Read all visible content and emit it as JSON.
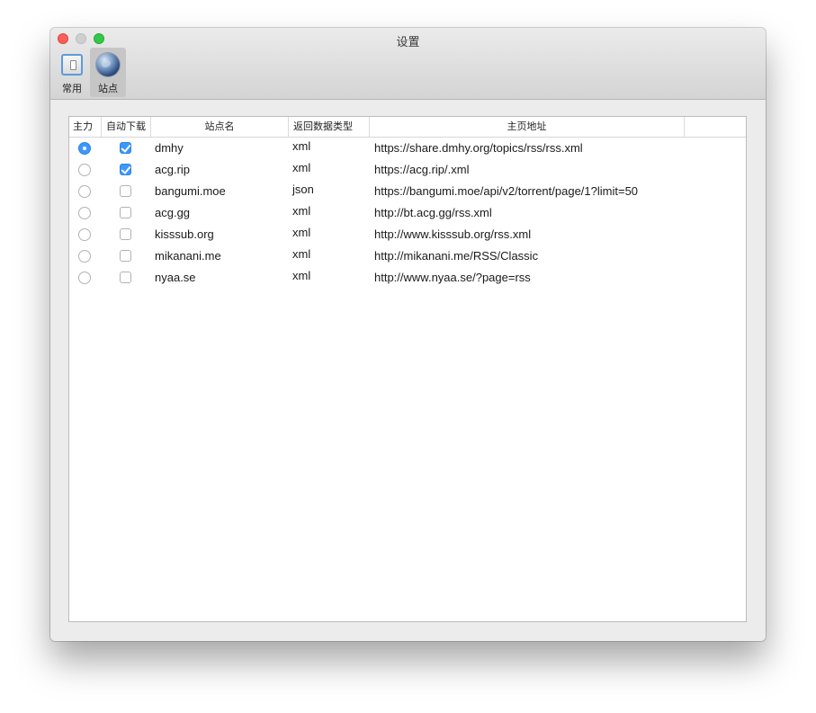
{
  "window": {
    "title": "设置"
  },
  "toolbar": {
    "items": [
      {
        "label": "常用",
        "icon": "general-settings-icon",
        "selected": false
      },
      {
        "label": "站点",
        "icon": "globe-icon",
        "selected": true
      }
    ]
  },
  "table": {
    "columns": [
      "主力",
      "自动下载",
      "站点名",
      "返回数据类型",
      "主页地址",
      ""
    ],
    "rows": [
      {
        "primary": true,
        "auto_download": true,
        "name": "dmhy",
        "type": "xml",
        "url": "https://share.dmhy.org/topics/rss/rss.xml"
      },
      {
        "primary": false,
        "auto_download": true,
        "name": "acg.rip",
        "type": "xml",
        "url": "https://acg.rip/.xml"
      },
      {
        "primary": false,
        "auto_download": false,
        "name": "bangumi.moe",
        "type": "json",
        "url": "https://bangumi.moe/api/v2/torrent/page/1?limit=50"
      },
      {
        "primary": false,
        "auto_download": false,
        "name": "acg.gg",
        "type": "xml",
        "url": "http://bt.acg.gg/rss.xml"
      },
      {
        "primary": false,
        "auto_download": false,
        "name": "kisssub.org",
        "type": "xml",
        "url": "http://www.kisssub.org/rss.xml"
      },
      {
        "primary": false,
        "auto_download": false,
        "name": "mikanani.me",
        "type": "xml",
        "url": "http://mikanani.me/RSS/Classic"
      },
      {
        "primary": false,
        "auto_download": false,
        "name": "nyaa.se",
        "type": "xml",
        "url": "http://www.nyaa.se/?page=rss"
      }
    ]
  },
  "colors": {
    "accent": "#3b99fc",
    "close": "#fc5f57",
    "zoom": "#34c84a"
  }
}
